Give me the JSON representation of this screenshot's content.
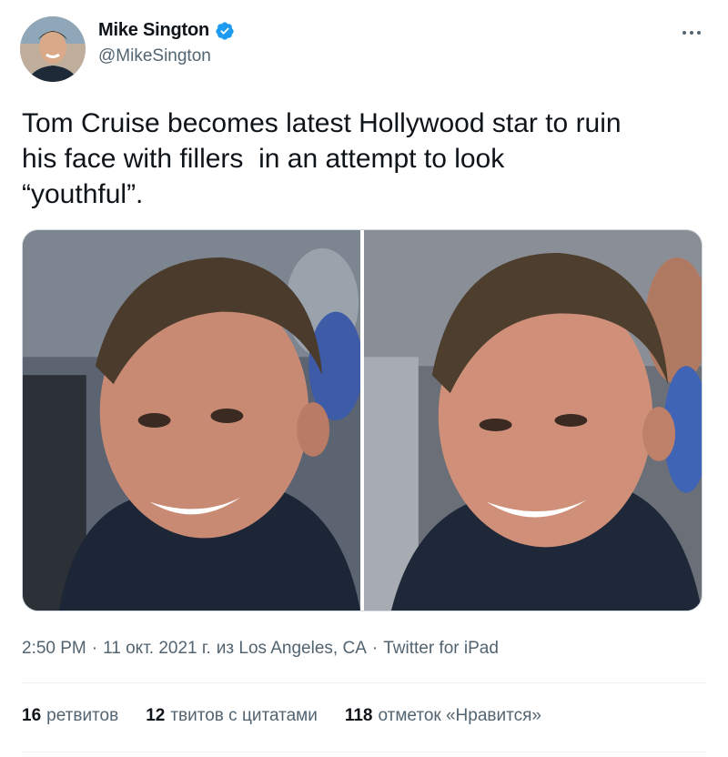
{
  "author": {
    "display_name": "Mike Sington",
    "handle": "@MikeSington",
    "verified": true
  },
  "tweet": {
    "text": "Tom Cruise becomes latest Hollywood star to ruin\nhis face with fillers  in an attempt to look\n“youthful”."
  },
  "meta": {
    "time": "2:50 PM",
    "date": "11 окт. 2021 г.",
    "location": "из Los Angeles, CA",
    "source": "Twitter for iPad",
    "separator": "·"
  },
  "stats": [
    {
      "count": "16",
      "label": "ретвитов"
    },
    {
      "count": "12",
      "label": "твитов с цитатами"
    },
    {
      "count": "118",
      "label": "отметок «Нравится»"
    }
  ],
  "icons": {
    "verified": "verified-badge-icon",
    "more": "more-options-icon"
  },
  "colors": {
    "verified_blue": "#1d9bf0",
    "text_primary": "#0f1419",
    "text_secondary": "#536471"
  }
}
